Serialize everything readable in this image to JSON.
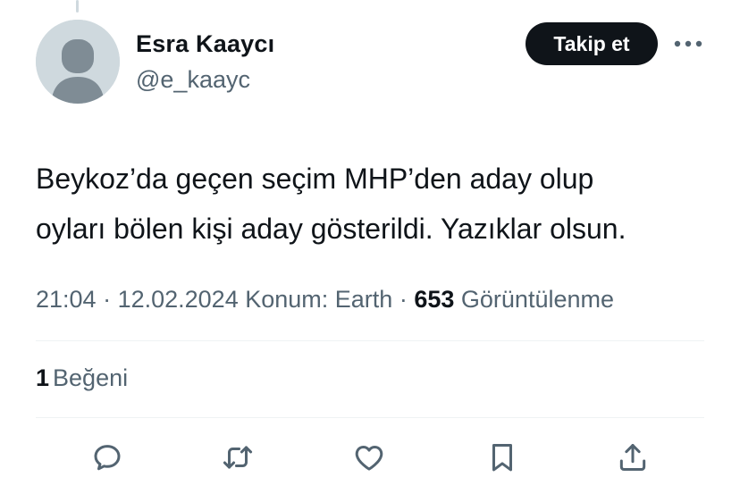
{
  "author": {
    "display_name": "Esra Kaaycı",
    "handle": "@e_kaayc"
  },
  "header": {
    "follow_label": "Takip et",
    "more_icon": "more-horizontal-icon"
  },
  "tweet": {
    "text_lines": [
      "Beykoz’da geçen seçim MHP’den aday olup",
      "oyları bölen kişi aday gösterildi. Yazıklar olsun."
    ]
  },
  "meta": {
    "time": "21:04",
    "separator": " · ",
    "date": "12.02.2024",
    "location": "Konum: Earth",
    "views_count": "653",
    "views_label": "Görüntülenme"
  },
  "engagement": {
    "likes_count": "1",
    "likes_label": "Beğeni"
  },
  "actions": {
    "icons": [
      "reply-icon",
      "repost-icon",
      "like-icon",
      "bookmark-icon",
      "share-icon"
    ]
  },
  "colors": {
    "text": "#0f1419",
    "secondary": "#536471",
    "divider": "#eff3f4",
    "avatar_bg": "#cfd9de",
    "avatar_fg": "#7f8c95"
  }
}
